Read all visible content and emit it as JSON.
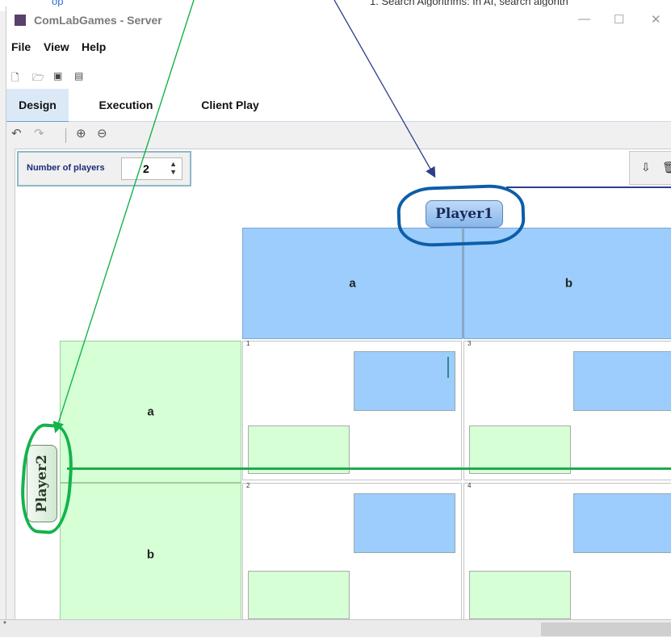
{
  "background_fragments": {
    "link": "op",
    "ghost": "1.  Search Algorithms: In AI, search algorith"
  },
  "window": {
    "title": "ComLabGames - Server",
    "minimize": "—",
    "maximize": "☐",
    "close": "✕"
  },
  "menus": [
    "File",
    "View",
    "Help"
  ],
  "toolbar_icons": [
    "new-file-icon",
    "open-folder-icon",
    "save-icon",
    "save-as-icon"
  ],
  "tabs": [
    "Design",
    "Execution",
    "Client Play"
  ],
  "active_tab": "Design",
  "design_tools": [
    "undo-icon",
    "redo-icon",
    "zoom-in-icon",
    "zoom-out-icon"
  ],
  "number_of_players": {
    "label": "Number of players",
    "value": "2"
  },
  "right_tools": [
    "import-icon",
    "delete-icon"
  ],
  "player1": {
    "name": "Player1"
  },
  "player2": {
    "name": "Player2"
  },
  "strategies": {
    "player1": [
      "a",
      "b"
    ],
    "player2": [
      "a",
      "b"
    ]
  },
  "outcome_numbers": [
    "1",
    "3",
    "2",
    "4"
  ],
  "status_text": "*",
  "colors": {
    "player1_blue": "#9ccdfd",
    "player2_green": "#d6ffd6",
    "annotation_blue": "#0d5ea8",
    "annotation_green": "#13b34b",
    "arrow_navy": "#2f3d8a"
  }
}
